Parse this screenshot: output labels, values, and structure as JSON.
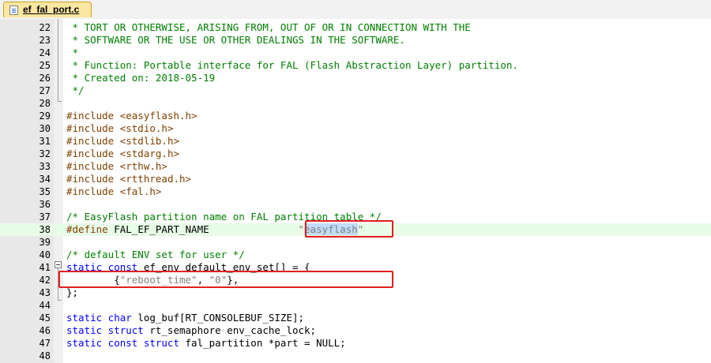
{
  "tab": {
    "filename": "ef_fal_port.c"
  },
  "lines": [
    {
      "no": "22",
      "parts": [
        {
          "c": "cmt",
          "t": " * TORT OR OTHERWISE, ARISING FROM, OUT OF OR IN CONNECTION WITH THE"
        }
      ]
    },
    {
      "no": "23",
      "parts": [
        {
          "c": "cmt",
          "t": " * SOFTWARE OR THE USE OR OTHER DEALINGS IN THE SOFTWARE."
        }
      ]
    },
    {
      "no": "24",
      "parts": [
        {
          "c": "cmt",
          "t": " *"
        }
      ]
    },
    {
      "no": "25",
      "parts": [
        {
          "c": "cmt",
          "t": " * Function: Portable interface for FAL (Flash Abstraction Layer) partition."
        }
      ]
    },
    {
      "no": "26",
      "parts": [
        {
          "c": "cmt",
          "t": " * Created on: 2018-05-19"
        }
      ]
    },
    {
      "no": "27",
      "parts": [
        {
          "c": "cmt",
          "t": " */"
        }
      ]
    },
    {
      "no": "28",
      "parts": []
    },
    {
      "no": "29",
      "parts": [
        {
          "c": "pp",
          "t": "#include "
        },
        {
          "c": "inc",
          "t": "<easyflash.h>"
        }
      ]
    },
    {
      "no": "30",
      "parts": [
        {
          "c": "pp",
          "t": "#include "
        },
        {
          "c": "inc",
          "t": "<stdio.h>"
        }
      ]
    },
    {
      "no": "31",
      "parts": [
        {
          "c": "pp",
          "t": "#include "
        },
        {
          "c": "inc",
          "t": "<stdlib.h>"
        }
      ]
    },
    {
      "no": "32",
      "parts": [
        {
          "c": "pp",
          "t": "#include "
        },
        {
          "c": "inc",
          "t": "<stdarg.h>"
        }
      ]
    },
    {
      "no": "33",
      "parts": [
        {
          "c": "pp",
          "t": "#include "
        },
        {
          "c": "inc",
          "t": "<rthw.h>"
        }
      ]
    },
    {
      "no": "34",
      "parts": [
        {
          "c": "pp",
          "t": "#include "
        },
        {
          "c": "inc",
          "t": "<rtthread.h>"
        }
      ]
    },
    {
      "no": "35",
      "parts": [
        {
          "c": "pp",
          "t": "#include "
        },
        {
          "c": "inc",
          "t": "<fal.h>"
        }
      ]
    },
    {
      "no": "36",
      "parts": []
    },
    {
      "no": "37",
      "parts": [
        {
          "c": "cmt",
          "t": "/* EasyFlash partition name on FAL partition table */"
        }
      ]
    },
    {
      "no": "38",
      "hl": true,
      "parts": [
        {
          "c": "pp",
          "t": "#define "
        },
        {
          "c": "",
          "t": "FAL_EF_PART_NAME               "
        },
        {
          "c": "str",
          "t": "\""
        },
        {
          "c": "sel",
          "t": "easyflash"
        },
        {
          "c": "str",
          "t": "\""
        }
      ]
    },
    {
      "no": "39",
      "parts": []
    },
    {
      "no": "40",
      "parts": [
        {
          "c": "cmt",
          "t": "/* default ENV set for user */"
        }
      ]
    },
    {
      "no": "41",
      "parts": [
        {
          "c": "kw",
          "t": "static const "
        },
        {
          "c": "",
          "t": "ef_env default_env_set[] = {"
        }
      ]
    },
    {
      "no": "42",
      "parts": [
        {
          "c": "",
          "t": "        {"
        },
        {
          "c": "str",
          "t": "\"reboot_time\""
        },
        {
          "c": "",
          "t": ", "
        },
        {
          "c": "str",
          "t": "\"0\""
        },
        {
          "c": "",
          "t": "},"
        }
      ]
    },
    {
      "no": "43",
      "parts": [
        {
          "c": "",
          "t": "};"
        }
      ]
    },
    {
      "no": "44",
      "parts": []
    },
    {
      "no": "45",
      "parts": [
        {
          "c": "kw",
          "t": "static char "
        },
        {
          "c": "",
          "t": "log_buf[RT_CONSOLEBUF_SIZE];"
        }
      ]
    },
    {
      "no": "46",
      "parts": [
        {
          "c": "kw",
          "t": "static struct "
        },
        {
          "c": "",
          "t": "rt_semaphore env_cache_lock;"
        }
      ]
    },
    {
      "no": "47",
      "parts": [
        {
          "c": "kw",
          "t": "static const struct "
        },
        {
          "c": "",
          "t": "fal_partition *part = NULL;"
        }
      ]
    },
    {
      "no": "48",
      "parts": []
    }
  ]
}
